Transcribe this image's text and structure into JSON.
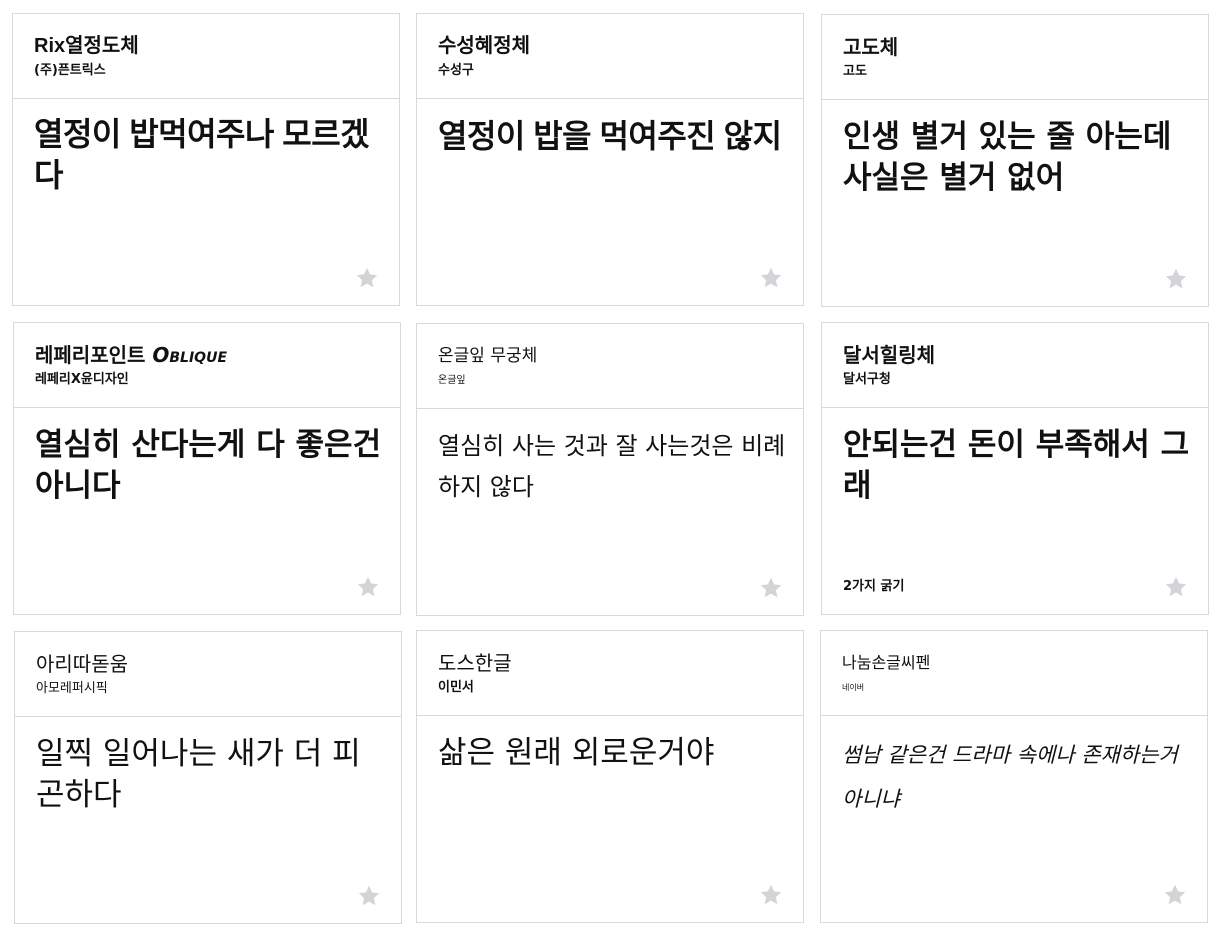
{
  "cards": [
    {
      "name": "Rix열정도체",
      "foundry": "(주)픈트릭스",
      "sample": "열정이 밥먹여주나 모르겠다",
      "note": ""
    },
    {
      "name": "수성혜정체",
      "foundry": "수성구",
      "sample": "열정이 밥을 먹여주진 않지",
      "note": ""
    },
    {
      "name": "고도체",
      "foundry": "고도",
      "sample": "인생 별거 있는 줄 아는데 사실은 별거 없어",
      "note": ""
    },
    {
      "name": "레페리포인트",
      "name_suffix": "Oblique",
      "foundry": "레페리X윤디자인",
      "sample": "열심히 산다는게 다 좋은건 아니다",
      "note": ""
    },
    {
      "name": "온글잎 무궁체",
      "foundry": "온글잎",
      "sample": "열심히 사는 것과 잘 사는것은 비례하지 않다",
      "note": ""
    },
    {
      "name": "달서힐링체",
      "foundry": "달서구청",
      "sample": "안되는건 돈이 부족해서 그래",
      "note": "2가지 굵기"
    },
    {
      "name": "아리따돋움",
      "foundry": "아모레퍼시픽",
      "sample": "일찍 일어나는 새가 더 피곤하다",
      "note": ""
    },
    {
      "name": "도스한글",
      "foundry": "이민서",
      "sample": "삶은 원래 외로운거야",
      "note": ""
    },
    {
      "name": "나눔손글씨펜",
      "foundry": "네이버",
      "sample": "썸남 같은건 드라마 속에나 존재하는거 아니냐",
      "note": ""
    }
  ],
  "icons": {
    "favorite": "star-icon",
    "favorite_color": "#d4d4d8"
  }
}
